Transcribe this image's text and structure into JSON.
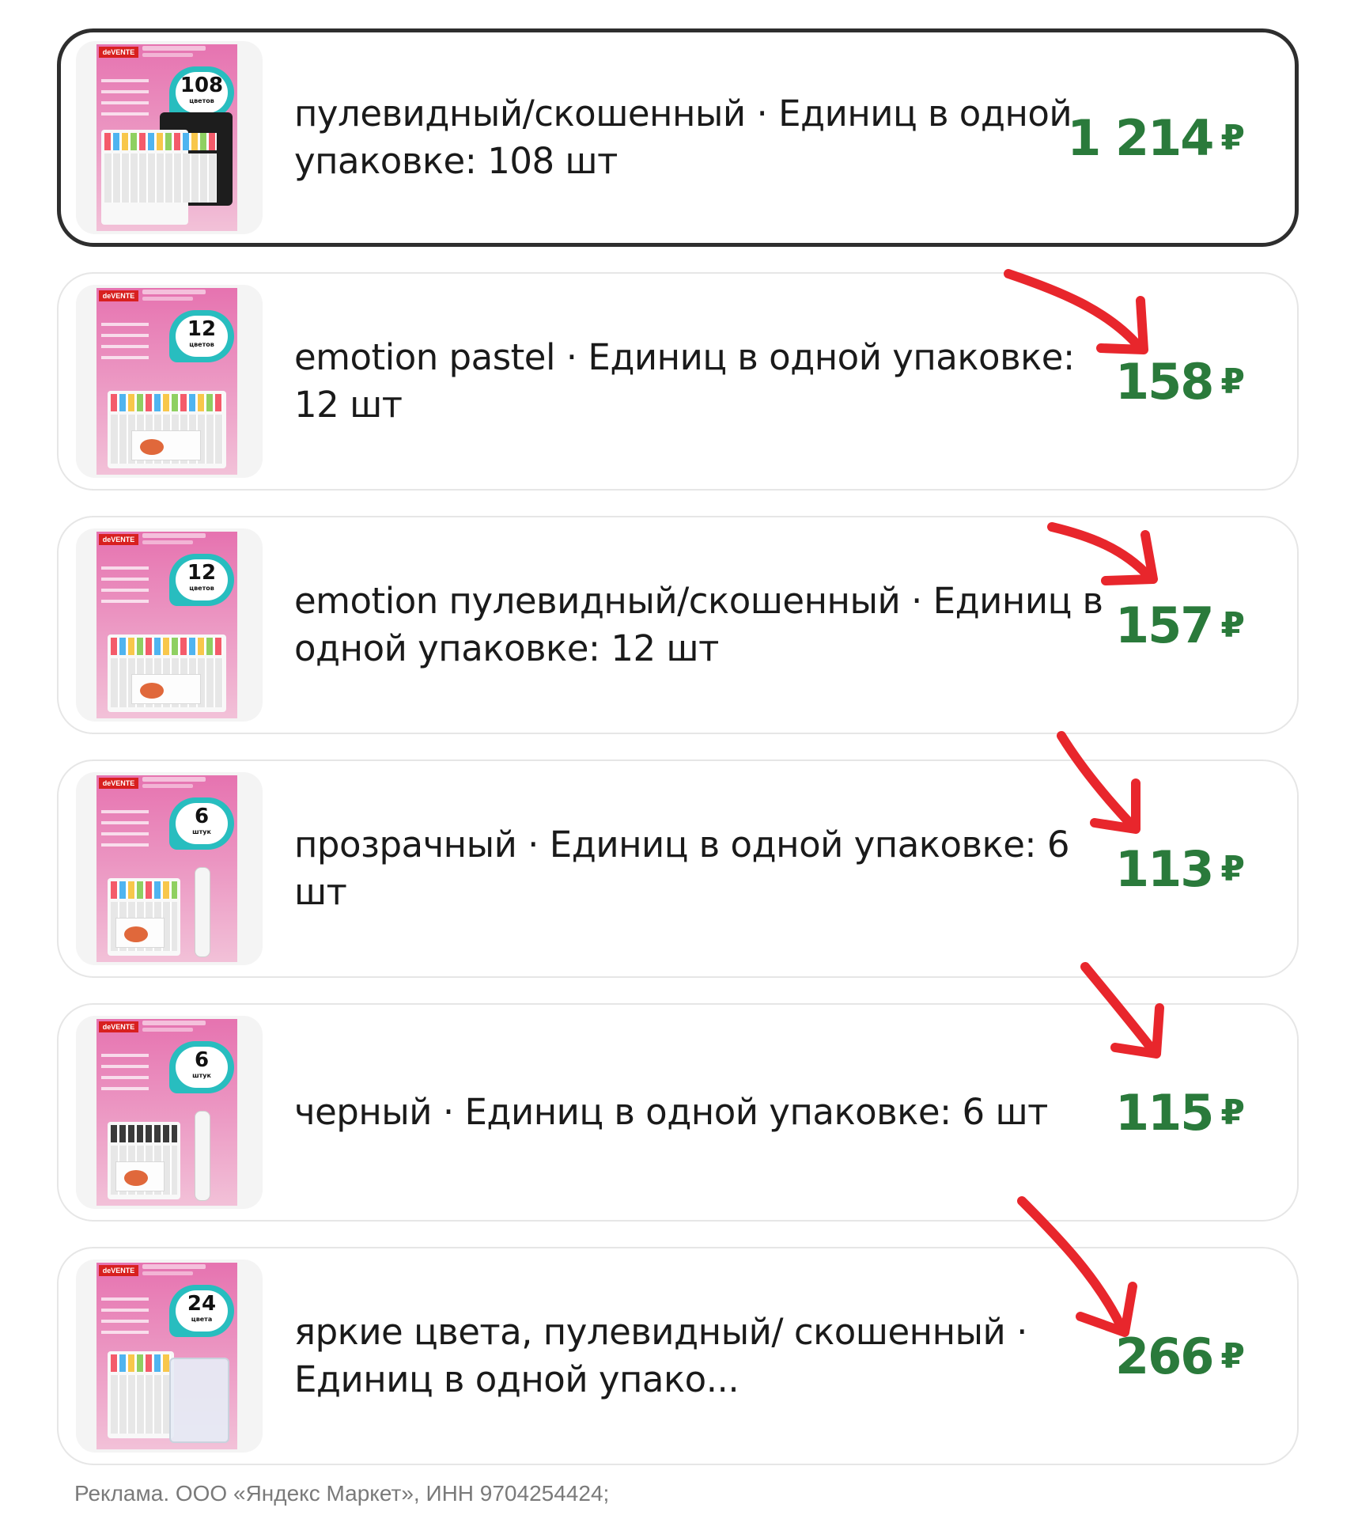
{
  "products": [
    {
      "title": "пулевидный/скошенный · Единиц в одной упаковке: 108 шт",
      "price": "1 214",
      "currency": "₽",
      "selected": true,
      "image": {
        "brand": "deVENTE",
        "badge_number": "108",
        "badge_sub": "цветов"
      }
    },
    {
      "title": "emotion pastel · Единиц в одной упаковке: 12 шт",
      "price": "158",
      "currency": "₽",
      "selected": false,
      "image": {
        "brand": "deVENTE",
        "badge_number": "12",
        "badge_sub": "цветов"
      }
    },
    {
      "title": "emotion пулевидный/скошенный · Единиц в одной упаковке: 12 шт",
      "price": "157",
      "currency": "₽",
      "selected": false,
      "image": {
        "brand": "deVENTE",
        "badge_number": "12",
        "badge_sub": "цветов"
      }
    },
    {
      "title": "прозрачный · Единиц в одной упаковке: 6 шт",
      "price": "113",
      "currency": "₽",
      "selected": false,
      "image": {
        "brand": "deVENTE",
        "badge_number": "6",
        "badge_sub": "штук"
      }
    },
    {
      "title": "черный · Единиц в одной упаковке: 6 шт",
      "price": "115",
      "currency": "₽",
      "selected": false,
      "image": {
        "brand": "deVENTE",
        "badge_number": "6",
        "badge_sub": "штук"
      }
    },
    {
      "title": "яркие цвета, пулевидный/ скошенный · Единиц в одной упако...",
      "price": "266",
      "currency": "₽",
      "selected": false,
      "image": {
        "brand": "deVENTE",
        "badge_number": "24",
        "badge_sub": "цвета"
      }
    }
  ],
  "footer": {
    "disclaimer": "Реклама. ООО «Яндекс Маркет», ИНН 9704254424;"
  },
  "colors": {
    "price": "#2a7a3b",
    "annotation_arrow": "#e8262c",
    "selected_border": "#2e2e2e",
    "card_border": "#e6e6e6"
  }
}
